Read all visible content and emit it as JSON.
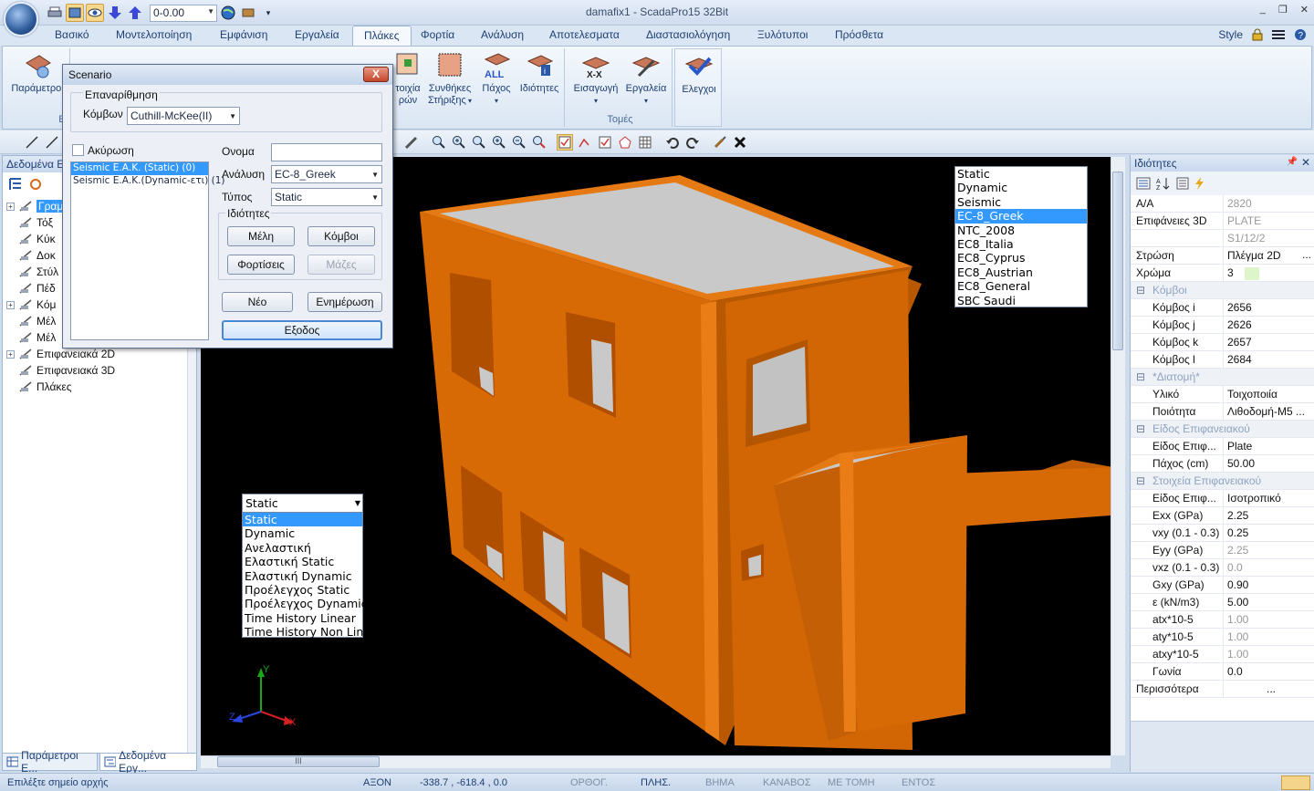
{
  "window": {
    "title": "damafix1 - ScadaPro15 32Bit",
    "qat_combo_value": "0-0.00",
    "controls": [
      "_",
      "❐",
      "✕"
    ]
  },
  "ribbon": {
    "tabs": [
      "Βασικό",
      "Μοντελοποίηση",
      "Εμφάνιση",
      "Εργαλεία",
      "Πλάκες",
      "Φορτία",
      "Ανάλυση",
      "Αποτελεσματα",
      "Διαστασιολόγηση",
      "Ξυλότυποι",
      "Πρόσθετα"
    ],
    "active_tab": "Πλάκες",
    "style_label": "Style",
    "buttons": {
      "params": "Παράμετροι",
      "elements_line1": "τοιχία",
      "elements_line2": "ρών",
      "support_line1": "Συνθήκες",
      "support_line2": "Στήριξης",
      "thickness": "Πάχος",
      "properties": "Ιδιότητες",
      "import": "Εισαγωγή",
      "tools": "Εργαλεία",
      "checks": "Ελεγχοι"
    },
    "group_captions": {
      "first": "Ει",
      "sections": "Τομές"
    }
  },
  "left_panel": {
    "title": "Δεδομένα Ερ",
    "tree": [
      {
        "label": "Γραμ",
        "expander": "+",
        "selected": true
      },
      {
        "label": "Τόξ",
        "expander": ""
      },
      {
        "label": "Κύκ",
        "expander": ""
      },
      {
        "label": "Δοκ",
        "expander": ""
      },
      {
        "label": "Στύλ",
        "expander": ""
      },
      {
        "label": "Πέδ",
        "expander": ""
      },
      {
        "label": "Κόμ",
        "expander": "+"
      },
      {
        "label": "Μέλ",
        "expander": ""
      },
      {
        "label": "Μέλ",
        "expander": ""
      },
      {
        "label": "Επιφανειακά 2D",
        "expander": "+"
      },
      {
        "label": "Επιφανειακά 3D",
        "expander": ""
      },
      {
        "label": "Πλάκες",
        "expander": ""
      }
    ],
    "bottom_tabs": [
      "Παράμετροι Ε...",
      "Δεδομένα Εργ..."
    ]
  },
  "dialog": {
    "title": "Scenario",
    "close": "X",
    "group_renumber": "Επαναρίθμηση",
    "nodes_label": "Κόμβων",
    "nodes_value": "Cuthill-McKee(II)",
    "cancel_label": "Ακύρωση",
    "scenarios": [
      "Seismic Ε.Α.Κ. (Static) (0)",
      "Seismic Ε.Α.Κ.(Dynamic-ετι) (1)"
    ],
    "selected_scenario": 0,
    "name_label": "Ονομα",
    "name_value": "",
    "analysis_label": "Ανάλυση",
    "analysis_value": "EC-8_Greek",
    "type_label": "Τύπος",
    "type_value": "Static",
    "properties_label": "Ιδιότητες",
    "btn_members": "Μέλη",
    "btn_nodes": "Κόμβοι",
    "btn_loads": "Φορτίσεις",
    "btn_masses": "Μάζες",
    "btn_new": "Νέο",
    "btn_update": "Ενημέρωση",
    "btn_exit": "Εξοδος"
  },
  "viewport": {
    "analysis_list": [
      "Static",
      "Dynamic",
      "Seismic",
      "EC-8_Greek",
      "NTC_2008",
      "EC8_Italia",
      "EC8_Cyprus",
      "EC8_Austrian",
      "EC8_General",
      "SBC Saudi"
    ],
    "analysis_selected": 3,
    "type_combo_value": "Static",
    "type_list": [
      "Static",
      "Dynamic",
      "Ανελαστική",
      "Ελαστική Static",
      "Ελαστική Dynamic",
      "Προέλεγχος Static",
      "Προέλεγχος Dynamic",
      "Time History Linear",
      "Time History Non Linear"
    ],
    "type_selected": 0,
    "axis_labels": {
      "x": "X",
      "y": "Y",
      "z": "Z"
    },
    "hscroll_grip": "III",
    "colors": {
      "building": "#d86a05",
      "building_dark": "#a84f00",
      "slab": "#c9c9c9",
      "background": "#000000"
    }
  },
  "properties": {
    "title": "Ιδιότητες",
    "rows": [
      {
        "k": "Α/Α",
        "v": "2820",
        "dim": true
      },
      {
        "k": "Επιφάνειες 3D",
        "v": "PLATE",
        "dim": true
      },
      {
        "k": "",
        "v": "S1/12/2",
        "dim": true
      },
      {
        "k": "Στρώση",
        "v": "Πλέγμα 2D",
        "btn": "..."
      },
      {
        "k": "Χρώμα",
        "v": "3",
        "swatch": "#ddf5c8"
      },
      {
        "cat": "Κόμβοι"
      },
      {
        "k": "Κόμβος i",
        "v": "2656",
        "ind": true
      },
      {
        "k": "Κόμβος j",
        "v": "2626",
        "ind": true
      },
      {
        "k": "Κόμβος k",
        "v": "2657",
        "ind": true
      },
      {
        "k": "Κόμβος l",
        "v": "2684",
        "ind": true
      },
      {
        "cat": "*Διατομή*"
      },
      {
        "k": "Υλικό",
        "v": "Τοιχοποιία",
        "ind": true
      },
      {
        "k": "Ποιότητα",
        "v": "Λιθοδομή-Μ5 ...",
        "ind": true
      },
      {
        "cat": "Είδος Επιφανειακού"
      },
      {
        "k": "Είδος Επιφ...",
        "v": "Plate",
        "ind": true
      },
      {
        "k": "Πάχος (cm)",
        "v": "50.00",
        "ind": true
      },
      {
        "cat": "Στοιχεία Επιφανειακού"
      },
      {
        "k": "Είδος Επιφ...",
        "v": "Ισοτροπικό",
        "ind": true
      },
      {
        "k": "Exx (GPa)",
        "v": "2.25",
        "ind": true
      },
      {
        "k": "vxy (0.1 - 0.3)",
        "v": "0.25",
        "ind": true
      },
      {
        "k": "Eyy (GPa)",
        "v": "2.25",
        "ind": true,
        "dim": true
      },
      {
        "k": "vxz (0.1 - 0.3)",
        "v": "0.0",
        "ind": true,
        "dim": true
      },
      {
        "k": "Gxy (GPa)",
        "v": "0.90",
        "ind": true
      },
      {
        "k": "ε (kN/m3)",
        "v": "5.00",
        "ind": true
      },
      {
        "k": "atx*10-5",
        "v": "1.00",
        "ind": true,
        "dim": true
      },
      {
        "k": "aty*10-5",
        "v": "1.00",
        "ind": true,
        "dim": true
      },
      {
        "k": "atxy*10-5",
        "v": "1.00",
        "ind": true,
        "dim": true
      },
      {
        "k": "Γωνία",
        "v": "0.0",
        "ind": true
      },
      {
        "k": "Περισσότερα",
        "v": "...",
        "center": true
      }
    ]
  },
  "statusbar": {
    "prompt": "Επιλέξτε σημείο αρχής",
    "axon": "ΑΞΟΝ",
    "coords": "-338.7 , -618.4 , 0.0",
    "ortho": "ΟΡΘΟΓ.",
    "plis": "ΠΛΗΣ.",
    "vima": "ΒΗΜΑ",
    "kanavos": "ΚΑΝΑΒΟΣ",
    "metomi": "ΜΕ ΤΟΜΗ",
    "entos": "ΕΝΤΟΣ"
  }
}
